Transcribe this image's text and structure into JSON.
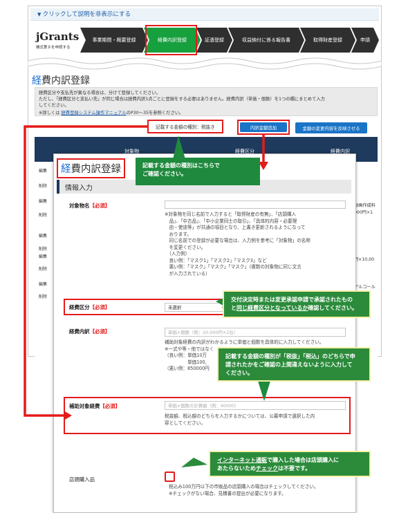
{
  "top": {
    "collapse_link": "クリックして説明を非表示にする",
    "logo": "jGrants",
    "logo_sub": "機式第８を申請する",
    "steps": [
      "事業期間・概要登録",
      "経費内訳登録",
      "証憑登録",
      "収益納付に係る報告書",
      "取得財産登録",
      "申請"
    ],
    "active_step_index": 1
  },
  "page": {
    "title_first": "経",
    "title_rest": "費内訳登録",
    "info_lines": [
      "経費区分や支払先が異なる場合は、分けて登録してください。",
      "ただし、「経費区分と支払い先」が同じ場合は経費内訳1点ごとに登録をする必要はありません。経費内訳（単価・個数）を1つの欄にまとめて入力",
      "してください。"
    ],
    "manual_prefix": "※詳しくは",
    "manual_link": "経費登録システム操作マニュアル",
    "manual_suffix": "のP30〜35を参照ください。",
    "tax_kind": "記載する金額の種別：税抜き",
    "btn_add": "内訳金額追加",
    "btn_reflect": "金額の変更内容を反映させる"
  },
  "bg_table": {
    "head_left": "対象物",
    "head_mid": "経費区分",
    "head_right": "経費内訳",
    "row_buttons": [
      "編集",
      "削除"
    ],
    "right_cells": [
      "動画作成料",
      "000円×1",
      "円×10,00",
      "アルコール"
    ]
  },
  "modal": {
    "title_first": "経",
    "title_rest": "費内訳登録",
    "section": "情報入力",
    "required": "【必須】",
    "target": {
      "label": "対象物名",
      "notes": [
        "※対象物を同じ名前で入力すると「取得財産の有無」、「店頭購入",
        "　品」、「中古品」、「中小企業同士の取引」、「具体的内容・必要理",
        "　由・使途等」が共通の項目となり、上書き更新されるようになって",
        "　おります。",
        "　同じ名前での登録が必要な場合は、入力例を参考に「対象物」の名称",
        "　を変更ください。",
        "　（入力例）",
        "　良い例：「マスク1」「マスク2」「マスク3」など",
        "　悪い例：「マスク」「マスク」「マスク」（複数の対象物に同じ文言",
        "　が入力されている）"
      ]
    },
    "category": {
      "label": "経費区分",
      "value": "未選択"
    },
    "detail": {
      "label": "経費内訳",
      "placeholder": "単価×個数（例：20,000円×2台）",
      "notes": [
        "補助対象経費の内訳がわかるように単価と個数を具体的に入力してください。",
        "※一式や等・他ではなく",
        "（良い例：単価10万",
        "　　　　　単価100,",
        "（悪い例：850000円"
      ]
    },
    "eligible": {
      "label": "補助対象経費",
      "placeholder": "単価×個数の計算額（例：40000）",
      "notes": [
        "税抜額、税込額のどちらを入力するかについては、公募申請で選択した内",
        "容としてください。"
      ]
    },
    "store": {
      "label": "店頭購入品",
      "notes": [
        "税込み100万円以下の市販品の店頭購入の場合はチェックしてください。",
        "※チェックがない場合、見積書の提出が必要になります。"
      ]
    }
  },
  "callouts": {
    "tax": [
      "記載する金額の種別はこちらで",
      "ご確認ください。"
    ],
    "category_1": "交付決定時または変更承認申請で承認されたもの",
    "category_2a": "と",
    "category_2b": "同じ経費区分となっているか",
    "category_2c": "確認してください。",
    "amount": [
      "記載する金額の種別が「税抜」「税込」のどちらで申",
      "請されたかをご確認の上間違えないように入力して",
      "ください。"
    ],
    "store_1a": "インターネット通販",
    "store_1b": "で購入した場合は店頭購入に",
    "store_2a": "あたらないため",
    "store_2b": "チェック",
    "store_2c": "は不要です。"
  },
  "colors": {
    "active_step": "#17a03e",
    "step": "#2f2f2f",
    "highlight_red": "#e51a1a",
    "callout_green": "#1f8a3d",
    "button_blue": "#1a74c7",
    "table_head": "#1e3a5c"
  }
}
